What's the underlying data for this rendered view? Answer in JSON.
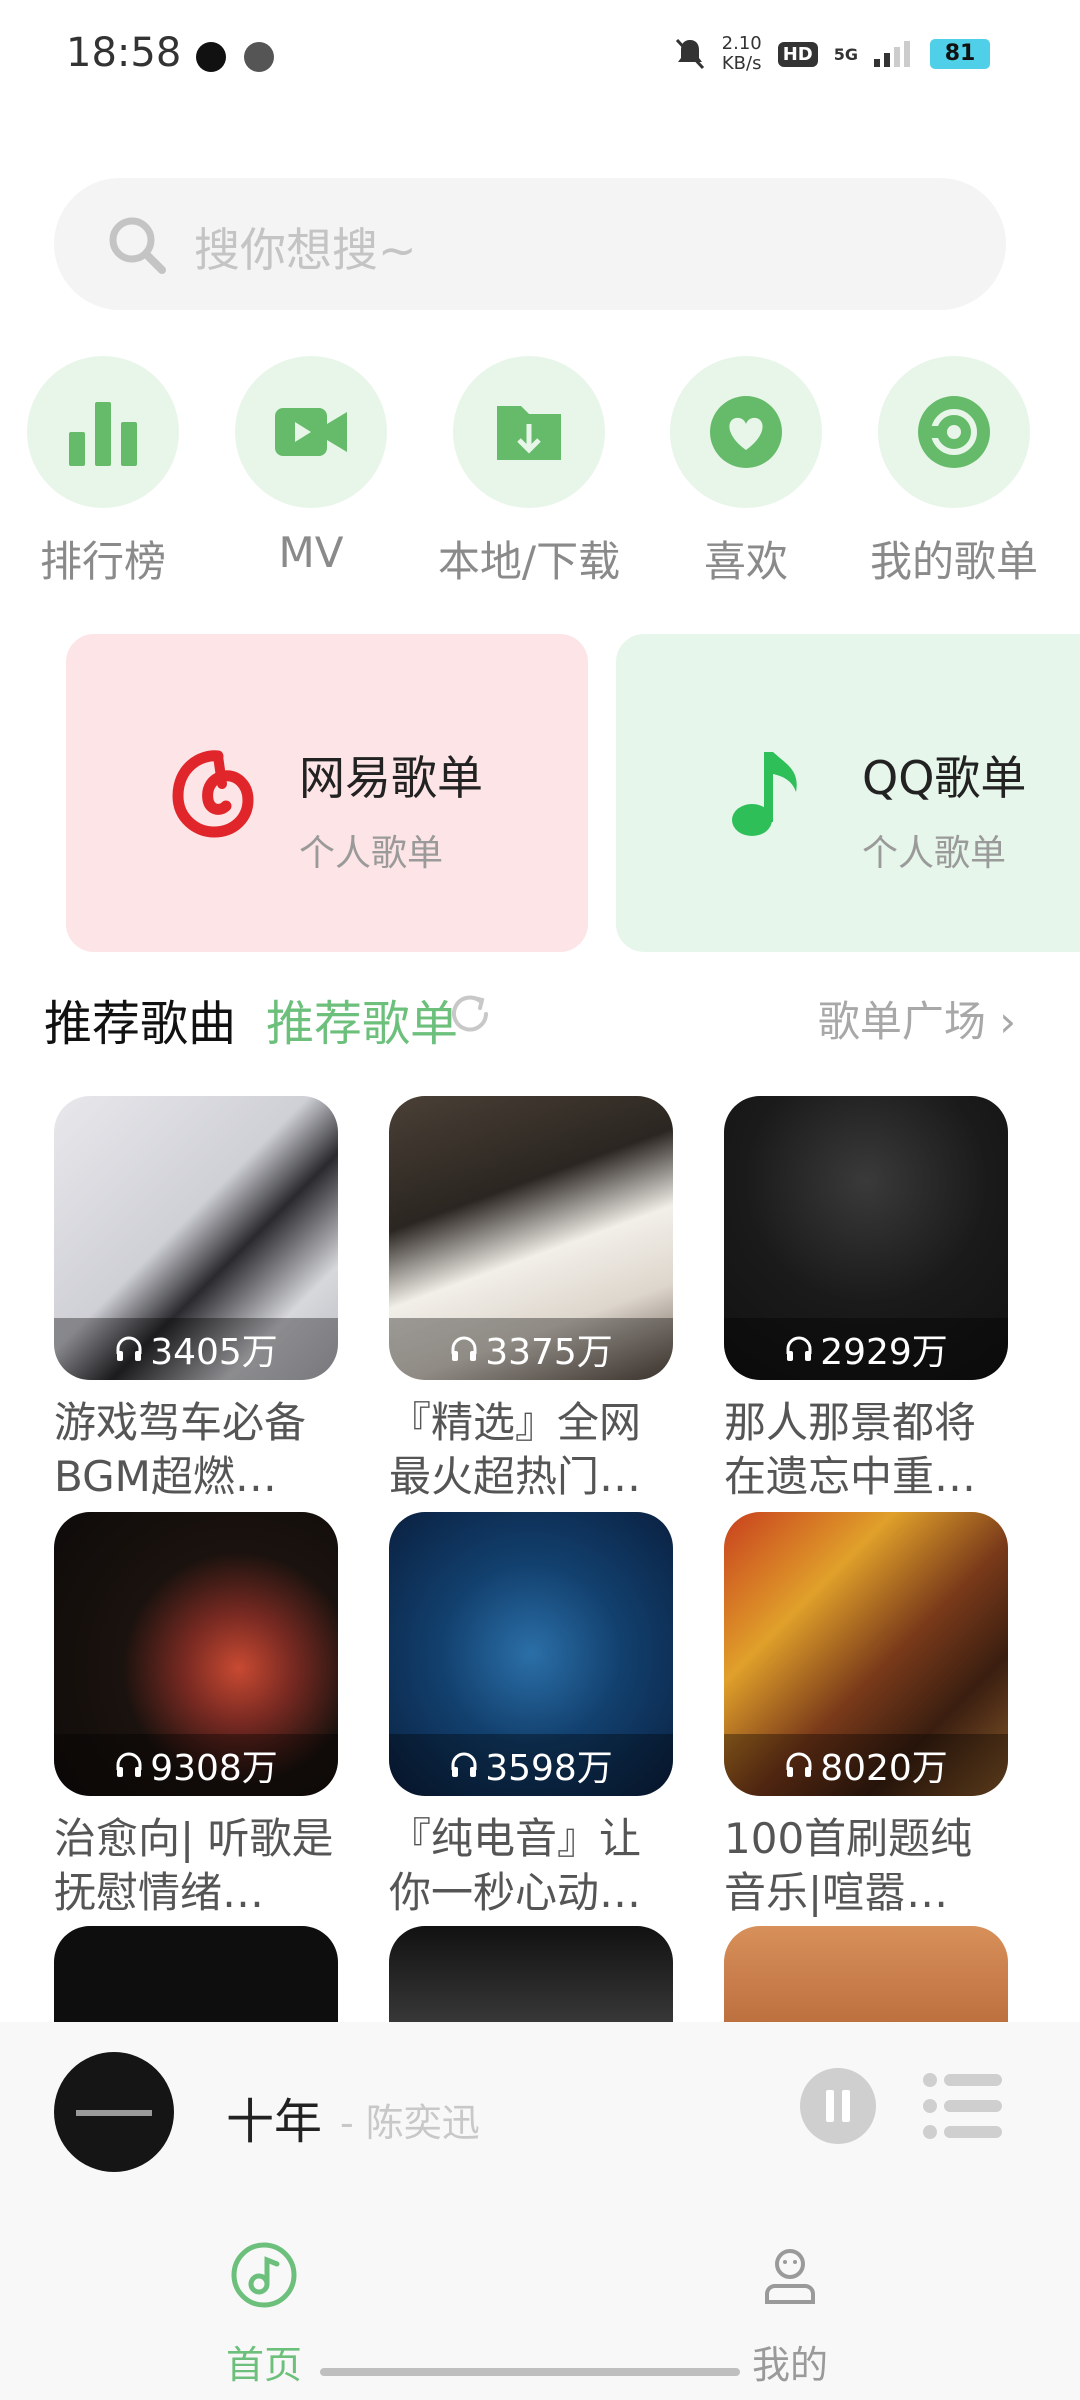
{
  "status_bar": {
    "time": "18:58",
    "speed_value": "2.10",
    "speed_unit": "KB/s",
    "hd": "HD",
    "network": "5G",
    "battery": "81"
  },
  "search": {
    "placeholder": "搜你想搜~"
  },
  "quick_entries": [
    {
      "label": "排行榜",
      "icon": "bar-chart-icon"
    },
    {
      "label": "MV",
      "icon": "video-camera-icon"
    },
    {
      "label": "本地/下载",
      "icon": "download-folder-icon"
    },
    {
      "label": "喜欢",
      "icon": "heart-icon"
    },
    {
      "label": "我的歌单",
      "icon": "disc-icon"
    }
  ],
  "playlist_cards": [
    {
      "title": "网易歌单",
      "subtitle": "个人歌单",
      "logo": "netease-logo-icon"
    },
    {
      "title": "QQ歌单",
      "subtitle": "个人歌单",
      "logo": "music-note-icon"
    }
  ],
  "section": {
    "tab_active": "推荐歌曲",
    "tab_other": "推荐歌单",
    "more": "歌单广场 ›"
  },
  "songs": [
    {
      "title": "游戏驾车必备BGM超燃…",
      "plays": "3405万"
    },
    {
      "title": "『精选』全网最火超热门…",
      "plays": "3375万"
    },
    {
      "title": "那人那景都将在遗忘中重…",
      "plays": "2929万"
    },
    {
      "title": "治愈向| 听歌是抚慰情绪…",
      "plays": "9308万"
    },
    {
      "title": "『纯电音』让你一秒心动…",
      "plays": "3598万"
    },
    {
      "title": "100首刷题纯音乐|喧嚣…",
      "plays": "8020万"
    }
  ],
  "player": {
    "song": "十年",
    "artist": "- 陈奕迅"
  },
  "nav": {
    "home": "首页",
    "mine": "我的"
  },
  "colors": {
    "accent": "#6cc07c",
    "accent_light": "#e8f5e9",
    "netease_bg": "#fde4e6",
    "qq_bg": "#e6f6ea"
  }
}
